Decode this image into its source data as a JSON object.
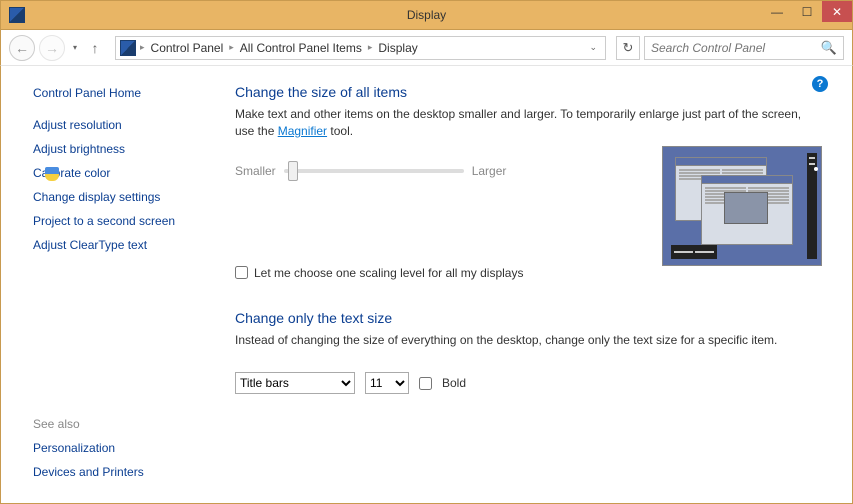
{
  "window": {
    "title": "Display"
  },
  "breadcrumb": {
    "items": [
      "Control Panel",
      "All Control Panel Items",
      "Display"
    ]
  },
  "search": {
    "placeholder": "Search Control Panel"
  },
  "sidebar": {
    "home": "Control Panel Home",
    "links": [
      "Adjust resolution",
      "Adjust brightness",
      "Calibrate color",
      "Change display settings",
      "Project to a second screen",
      "Adjust ClearType text"
    ],
    "see_also_title": "See also",
    "see_also": [
      "Personalization",
      "Devices and Printers"
    ]
  },
  "main": {
    "heading1": "Change the size of all items",
    "desc1a": "Make text and other items on the desktop smaller and larger. To temporarily enlarge just part of the screen, use the ",
    "magnifier": "Magnifier",
    "desc1b": " tool.",
    "slider_min": "Smaller",
    "slider_max": "Larger",
    "checkbox_label": "Let me choose one scaling level for all my displays",
    "heading2": "Change only the text size",
    "desc2": "Instead of changing the size of everything on the desktop, change only the text size for a specific item.",
    "item_select": "Title bars",
    "size_select": "11",
    "bold_label": "Bold"
  }
}
